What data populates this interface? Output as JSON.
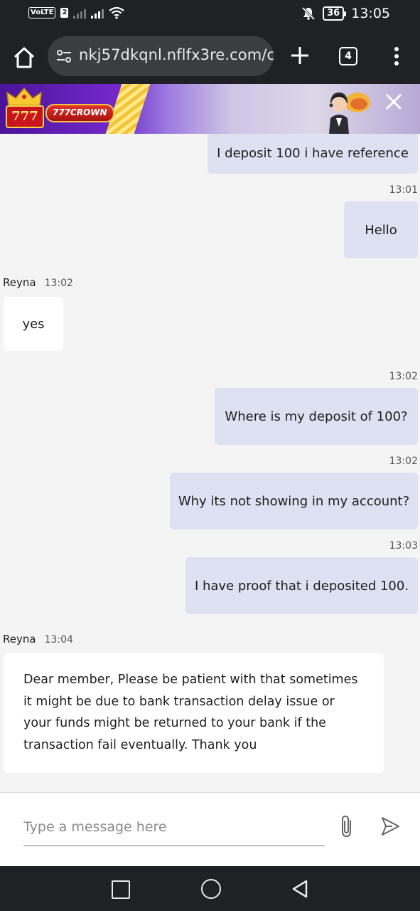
{
  "status_bar": {
    "volte": "VoLTE",
    "sim": "2",
    "battery": "36",
    "time": "13:05"
  },
  "browser": {
    "url": "nkj57dkqnl.nflfx3re.com/cl",
    "tab_count": "4"
  },
  "banner": {
    "slot": "777",
    "brand": "777CROWN"
  },
  "chat": {
    "messages": [
      {
        "side": "out",
        "text": "I deposit 100 i have reference"
      },
      {
        "side": "out",
        "time": "13:01",
        "text": "Hello"
      },
      {
        "side": "in",
        "sender": "Reyna",
        "time": "13:02",
        "text": "yes"
      },
      {
        "side": "out",
        "time": "13:02",
        "text": "Where is my deposit of 100?"
      },
      {
        "side": "out",
        "time": "13:02",
        "text": "Why its not showing in my account?"
      },
      {
        "side": "out",
        "time": "13:03",
        "text": "I have proof that i deposited 100."
      },
      {
        "side": "in",
        "sender": "Reyna",
        "time": "13:04",
        "text": "Dear member, Please be patient with that sometimes it might be due to bank transaction delay issue or your funds might be returned to your bank if the transaction fail eventually. Thank you"
      }
    ]
  },
  "composer": {
    "placeholder": "Type a message here"
  },
  "icons": {
    "home": "home-icon",
    "tune": "site-settings-icon",
    "new_tab": "plus-icon",
    "menu": "kebab-menu-icon",
    "attach": "paperclip-icon",
    "send": "send-icon",
    "close": "close-icon"
  },
  "colors": {
    "outgoing_bubble": "#dde1f2",
    "incoming_bubble": "#ffffff",
    "chat_background": "#f4f4f4",
    "system_bar": "#202124"
  }
}
